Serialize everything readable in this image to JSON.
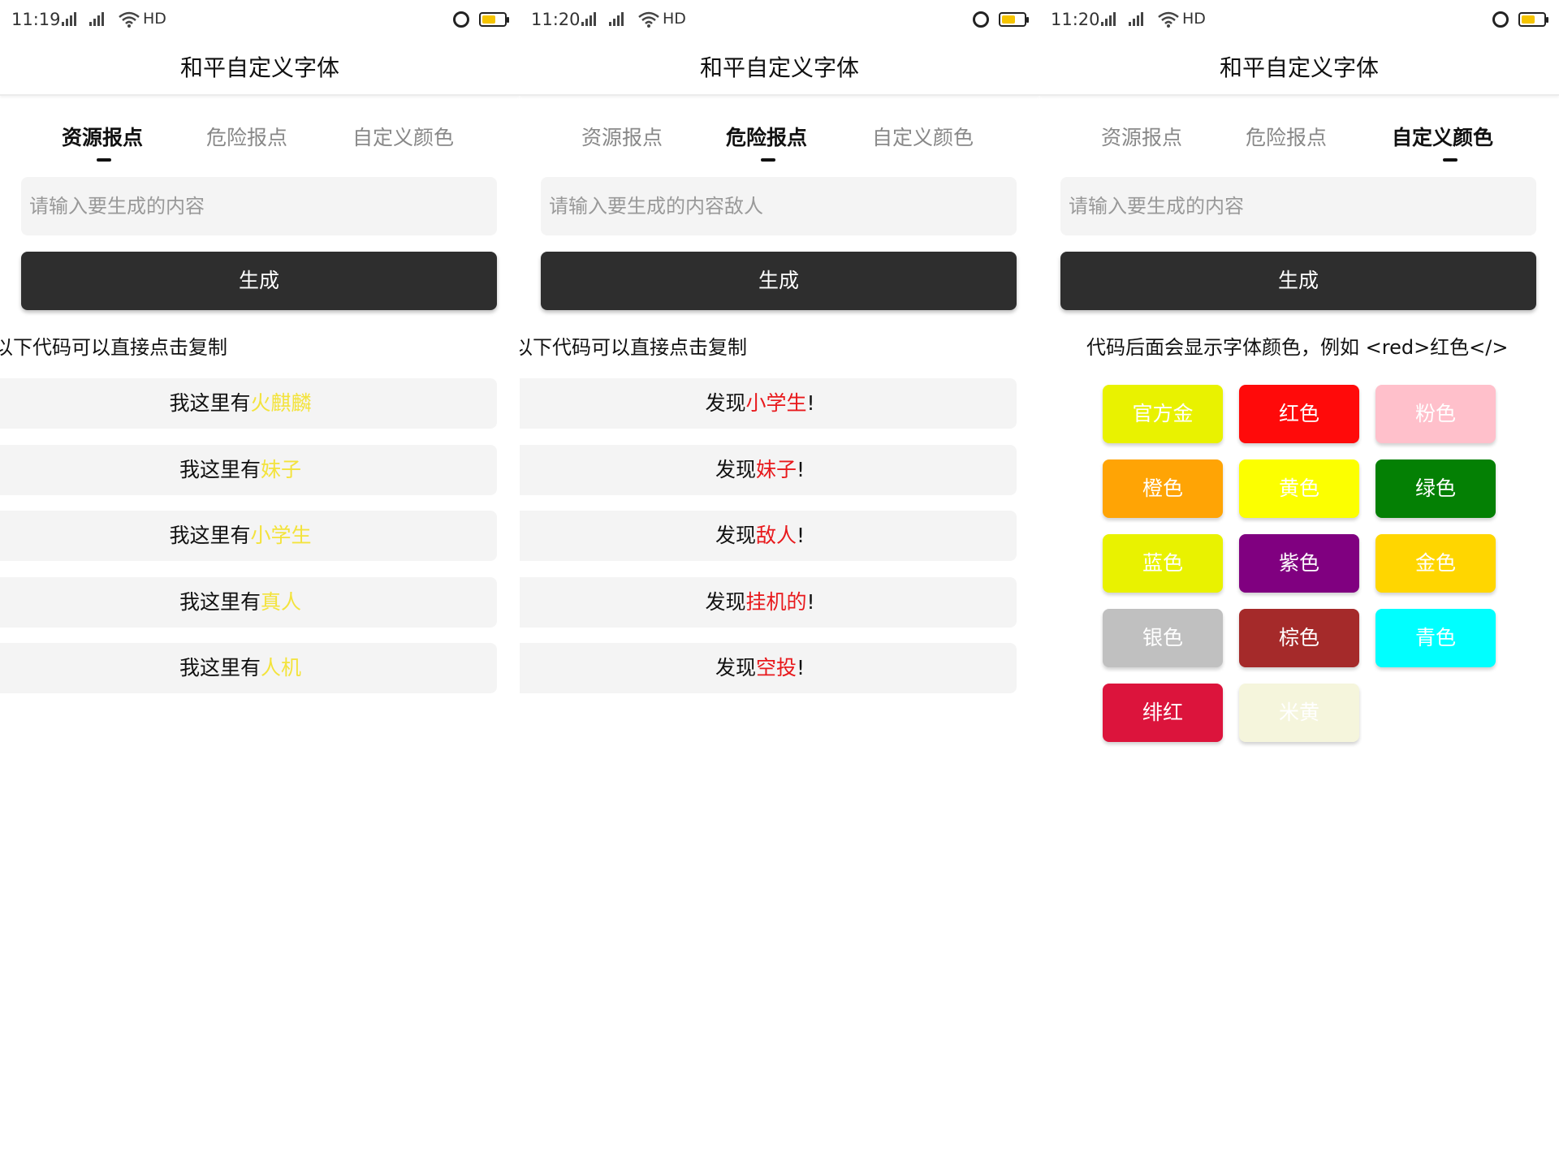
{
  "app_title": "和平自定义字体",
  "tabs": [
    "资源报点",
    "危险报点",
    "自定义颜色"
  ],
  "generate_label": "生成",
  "panels": [
    {
      "time": "11:19",
      "network": "HD",
      "input_placeholder": "请输入要生成的内容",
      "hint": "以下代码可以直接点击复制",
      "items": [
        {
          "prefix": "我这里有",
          "highlight": "火麒麟",
          "suffix": ""
        },
        {
          "prefix": "我这里有",
          "highlight": "妹子",
          "suffix": ""
        },
        {
          "prefix": "我这里有",
          "highlight": "小学生",
          "suffix": ""
        },
        {
          "prefix": "我这里有",
          "highlight": "真人",
          "suffix": ""
        },
        {
          "prefix": "我这里有",
          "highlight": "人机",
          "suffix": ""
        }
      ],
      "highlight_color": "#f3e33c"
    },
    {
      "time": "11:20",
      "network": "HD",
      "input_placeholder": "请输入要生成的内容敌人",
      "hint": "以下代码可以直接点击复制",
      "items": [
        {
          "prefix": "发现",
          "highlight": "小学生",
          "suffix": "!"
        },
        {
          "prefix": "发现",
          "highlight": "妹子",
          "suffix": "!"
        },
        {
          "prefix": "发现",
          "highlight": "敌人",
          "suffix": "!"
        },
        {
          "prefix": "发现",
          "highlight": "挂机的",
          "suffix": "!"
        },
        {
          "prefix": "发现",
          "highlight": "空投",
          "suffix": "!"
        }
      ],
      "highlight_color": "#e8191c"
    },
    {
      "time": "11:20",
      "network": "HD",
      "input_placeholder": "请输入要生成的内容",
      "hint": "代码后面会显示字体颜色，例如 <red>红色</>",
      "colors": [
        {
          "label": "官方金",
          "color": "#e9f200"
        },
        {
          "label": "红色",
          "color": "#ff0a0a"
        },
        {
          "label": "粉色",
          "color": "#ffc0cb"
        },
        {
          "label": "橙色",
          "color": "#ffa405"
        },
        {
          "label": "黄色",
          "color": "#fcff00"
        },
        {
          "label": "绿色",
          "color": "#048004"
        },
        {
          "label": "蓝色",
          "color": "#e9f200"
        },
        {
          "label": "紫色",
          "color": "#800080"
        },
        {
          "label": "金色",
          "color": "#ffd600"
        },
        {
          "label": "银色",
          "color": "#c0c0c0"
        },
        {
          "label": "棕色",
          "color": "#a52a2a"
        },
        {
          "label": "青色",
          "color": "#00ffff"
        },
        {
          "label": "绯红",
          "color": "#dc143c"
        },
        {
          "label": "米黄",
          "color": "#f5f5dc"
        }
      ]
    }
  ]
}
